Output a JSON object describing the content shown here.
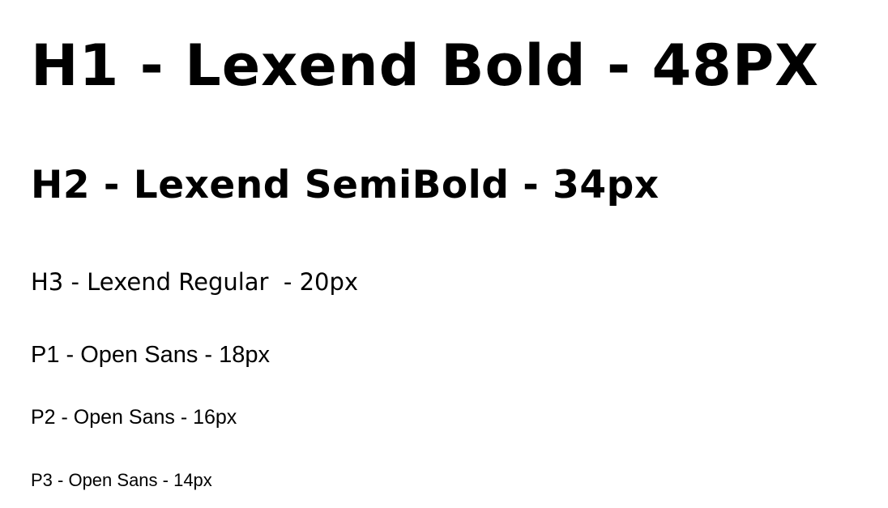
{
  "type_scale": {
    "h1": "H1 - Lexend Bold - 48PX",
    "h2": "H2 - Lexend SemiBold - 34px",
    "h3": "H3 - Lexend Regular  - 20px",
    "p1": "P1 - Open Sans - 18px",
    "p2": "P2 - Open Sans - 16px",
    "p3": "P3 - Open Sans - 14px"
  },
  "colors": {
    "background": "#ffffff",
    "text": "#000000"
  }
}
